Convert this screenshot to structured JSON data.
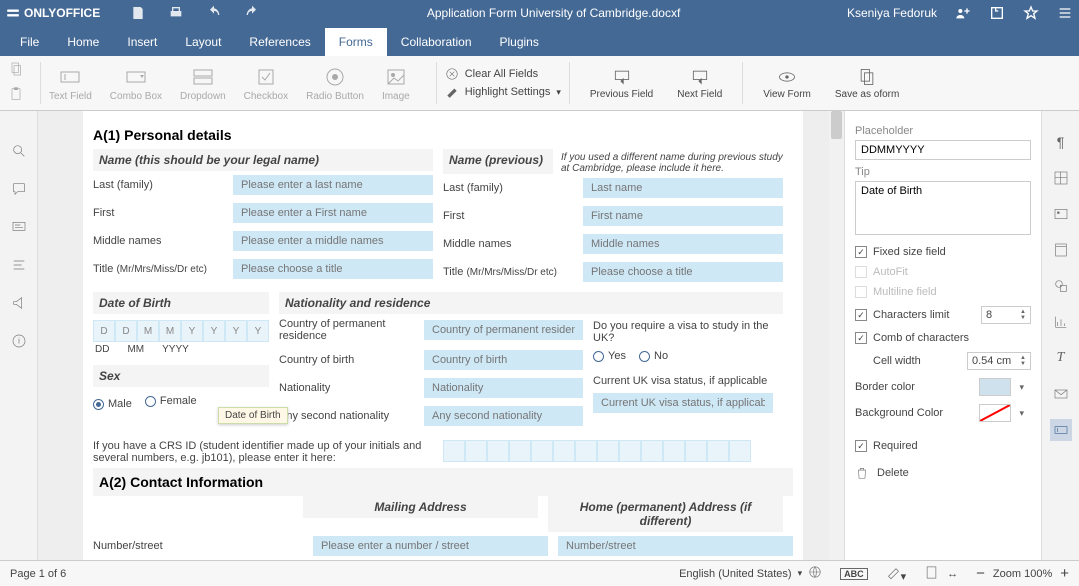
{
  "app": {
    "brand": "ONLYOFFICE",
    "doc_title": "Application Form University of Cambridge.docxf",
    "user_name": "Kseniya Fedoruk"
  },
  "menubar": {
    "tabs": [
      "File",
      "Home",
      "Insert",
      "Layout",
      "References",
      "Forms",
      "Collaboration",
      "Plugins"
    ],
    "active_index": 5
  },
  "ribbon": {
    "controls": [
      "Text Field",
      "Combo Box",
      "Dropdown",
      "Checkbox",
      "Radio Button",
      "Image"
    ],
    "clear_all": "Clear All Fields",
    "highlight": "Highlight Settings",
    "prev": "Previous Field",
    "next": "Next Field",
    "view_form": "View Form",
    "save_oform": "Save as oform"
  },
  "headings": {
    "a1": "A(1) Personal details",
    "name_legal": "Name (this should be your legal name)",
    "name_prev": "Name (previous)",
    "name_note": "If you used a different name during previous study at Cambridge, please include it here.",
    "dob": "Date of Birth",
    "nat": "Nationality and residence",
    "sex": "Sex",
    "a2": "A(2) Contact Information",
    "mailing": "Mailing Address",
    "home": "Home (permanent) Address (if different)"
  },
  "tooltip": "Date of Birth",
  "labels": {
    "last": "Last (family)",
    "first": "First",
    "middle": "Middle names",
    "title": "Title",
    "title_hint": "(Mr/Mrs/Miss/Dr etc)",
    "dd": "DD",
    "mm": "MM",
    "yyyy": "YYYY",
    "male": "Male",
    "female": "Female",
    "cpr": "Country of permanent residence",
    "cob": "Country of birth",
    "nat": "Nationality",
    "nat2": "Any second nationality",
    "visa_q": "Do you require a visa to study in the UK?",
    "yes": "Yes",
    "no": "No",
    "visa_status": "Current UK visa status, if applicable",
    "crs": "If you have a CRS ID (student identifier made up of your initials and several numbers, e.g. jb101), please enter it here:",
    "numstreet": "Number/street"
  },
  "placeholders": {
    "last": "Please enter a last name",
    "first": "Please enter a First name",
    "middle": "Please enter a middle names",
    "title": "Please choose a title",
    "p_last": "Last name",
    "p_first": "First name",
    "p_middle": "Middle names",
    "p_title": "Please choose a title",
    "cpr": "Country of permanent residence",
    "cob": "Country of birth",
    "nat": "Nationality",
    "nat2": "Any second nationality",
    "visa": "Current UK visa status, if applicable",
    "numstreet": "Please enter a number / street",
    "h_numstreet": "Number/street"
  },
  "comb_letters": [
    "D",
    "D",
    "M",
    "M",
    "Y",
    "Y",
    "Y",
    "Y"
  ],
  "panel": {
    "ph_label": "Placeholder",
    "ph_value": "DDMMYYYY",
    "tip_label": "Tip",
    "tip_value": "Date of Birth",
    "fixed": "Fixed size field",
    "autofit": "AutoFit",
    "multiline": "Multiline field",
    "chars_limit": "Characters limit",
    "chars_limit_val": "8",
    "comb": "Comb of characters",
    "cell_width": "Cell width",
    "cell_width_val": "0.54 cm",
    "border": "Border color",
    "bg": "Background Color",
    "required": "Required",
    "delete": "Delete"
  },
  "colors": {
    "border_color": "#cfe1ec",
    "bg_none": true
  },
  "status": {
    "page": "Page 1 of 6",
    "language": "English (United States)",
    "zoom": "Zoom 100%"
  }
}
